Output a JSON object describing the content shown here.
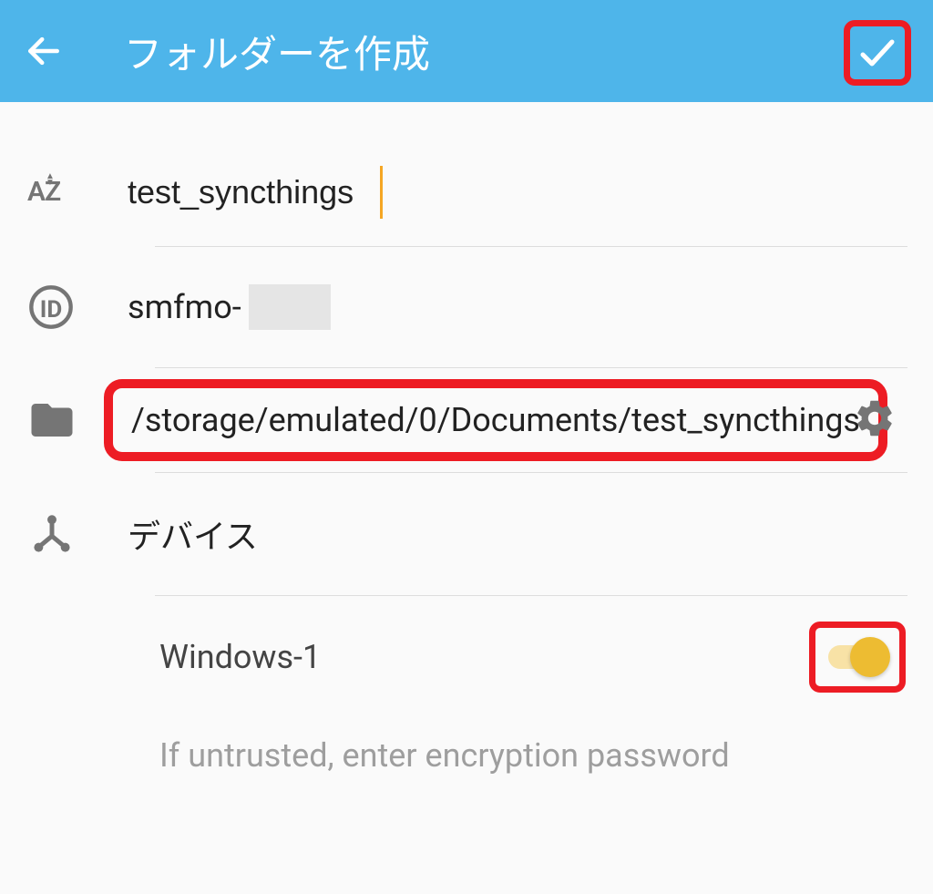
{
  "header": {
    "title": "フォルダーを作成"
  },
  "fields": {
    "name": "test_syncthings",
    "id_prefix": "smfmo-",
    "path": "/storage/emulated/0/Documents/test_syncthings",
    "devices_label": "デバイス"
  },
  "devices": [
    {
      "name": "Windows-1",
      "enabled": true
    }
  ],
  "encryption": {
    "placeholder": "If untrusted, enter encryption password"
  }
}
